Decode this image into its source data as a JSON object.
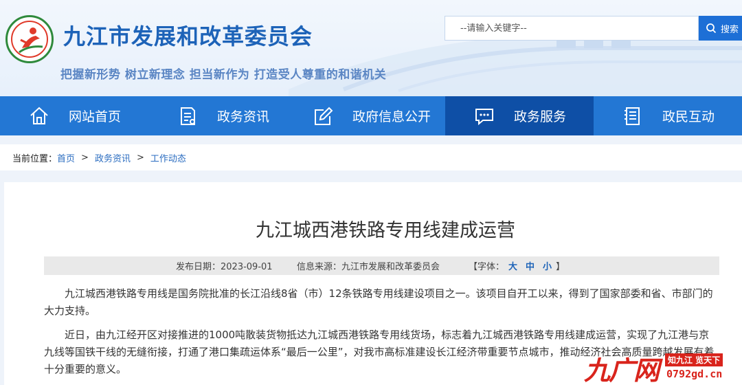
{
  "header": {
    "site_title": "九江市发展和改革委员会",
    "slogan": "把握新形势 树立新理念 担当新作为 打造受人尊重的和谐机关",
    "logo_icon": "jiujiang-ndrc-emblem-icon",
    "search": {
      "placeholder": "--请输入关键字--",
      "button_label": "搜索",
      "button_icon": "search-icon"
    }
  },
  "nav": {
    "items": [
      {
        "label": "网站首页",
        "icon": "home-icon",
        "active": false
      },
      {
        "label": "政务资讯",
        "icon": "document-list-icon",
        "active": false
      },
      {
        "label": "政府信息公开",
        "icon": "edit-icon",
        "active": false
      },
      {
        "label": "政务服务",
        "icon": "chat-bubble-icon",
        "active": true
      },
      {
        "label": "政民互动",
        "icon": "notepad-icon",
        "active": false
      }
    ]
  },
  "breadcrumb": {
    "label": "当前位置：",
    "items": [
      "首页",
      "政务资讯",
      "工作动态"
    ],
    "separator": ">"
  },
  "article": {
    "title": "九江城西港铁路专用线建成运营",
    "meta": {
      "date": "发布日期：2023-09-01",
      "source": "信息来源：九江市发展和改革委员会",
      "font_label": "【字体：",
      "font_large": "大",
      "font_medium": "中",
      "font_small": "小",
      "font_close": "】"
    },
    "paragraphs": [
      "九江城西港铁路专用线是国务院批准的长江沿线8省（市）12条铁路专用线建设项目之一。该项目自开工以来，得到了国家部委和省、市部门的大力支持。",
      "近日，由九江经开区对接推进的1000吨散装货物抵达九江城西港铁路专用线货场，标志着九江城西港铁路专用线建成运营，实现了九江港与京九线等国铁干线的无缝衔接，打通了港口集疏运体系“最后一公里”，对我市高标准建设长江经济带重要节点城市，推动经济社会高质量跨越发展有着十分重要的意义。"
    ]
  },
  "watermark": {
    "brand": "九广网",
    "tag": "知九江 览天下",
    "url": "0792gd.cn"
  },
  "colors": {
    "brand_blue": "#1d63b8",
    "nav_bg": "#2377d4",
    "nav_active": "#0e4fa6",
    "watermark_red": "#d9241c"
  }
}
